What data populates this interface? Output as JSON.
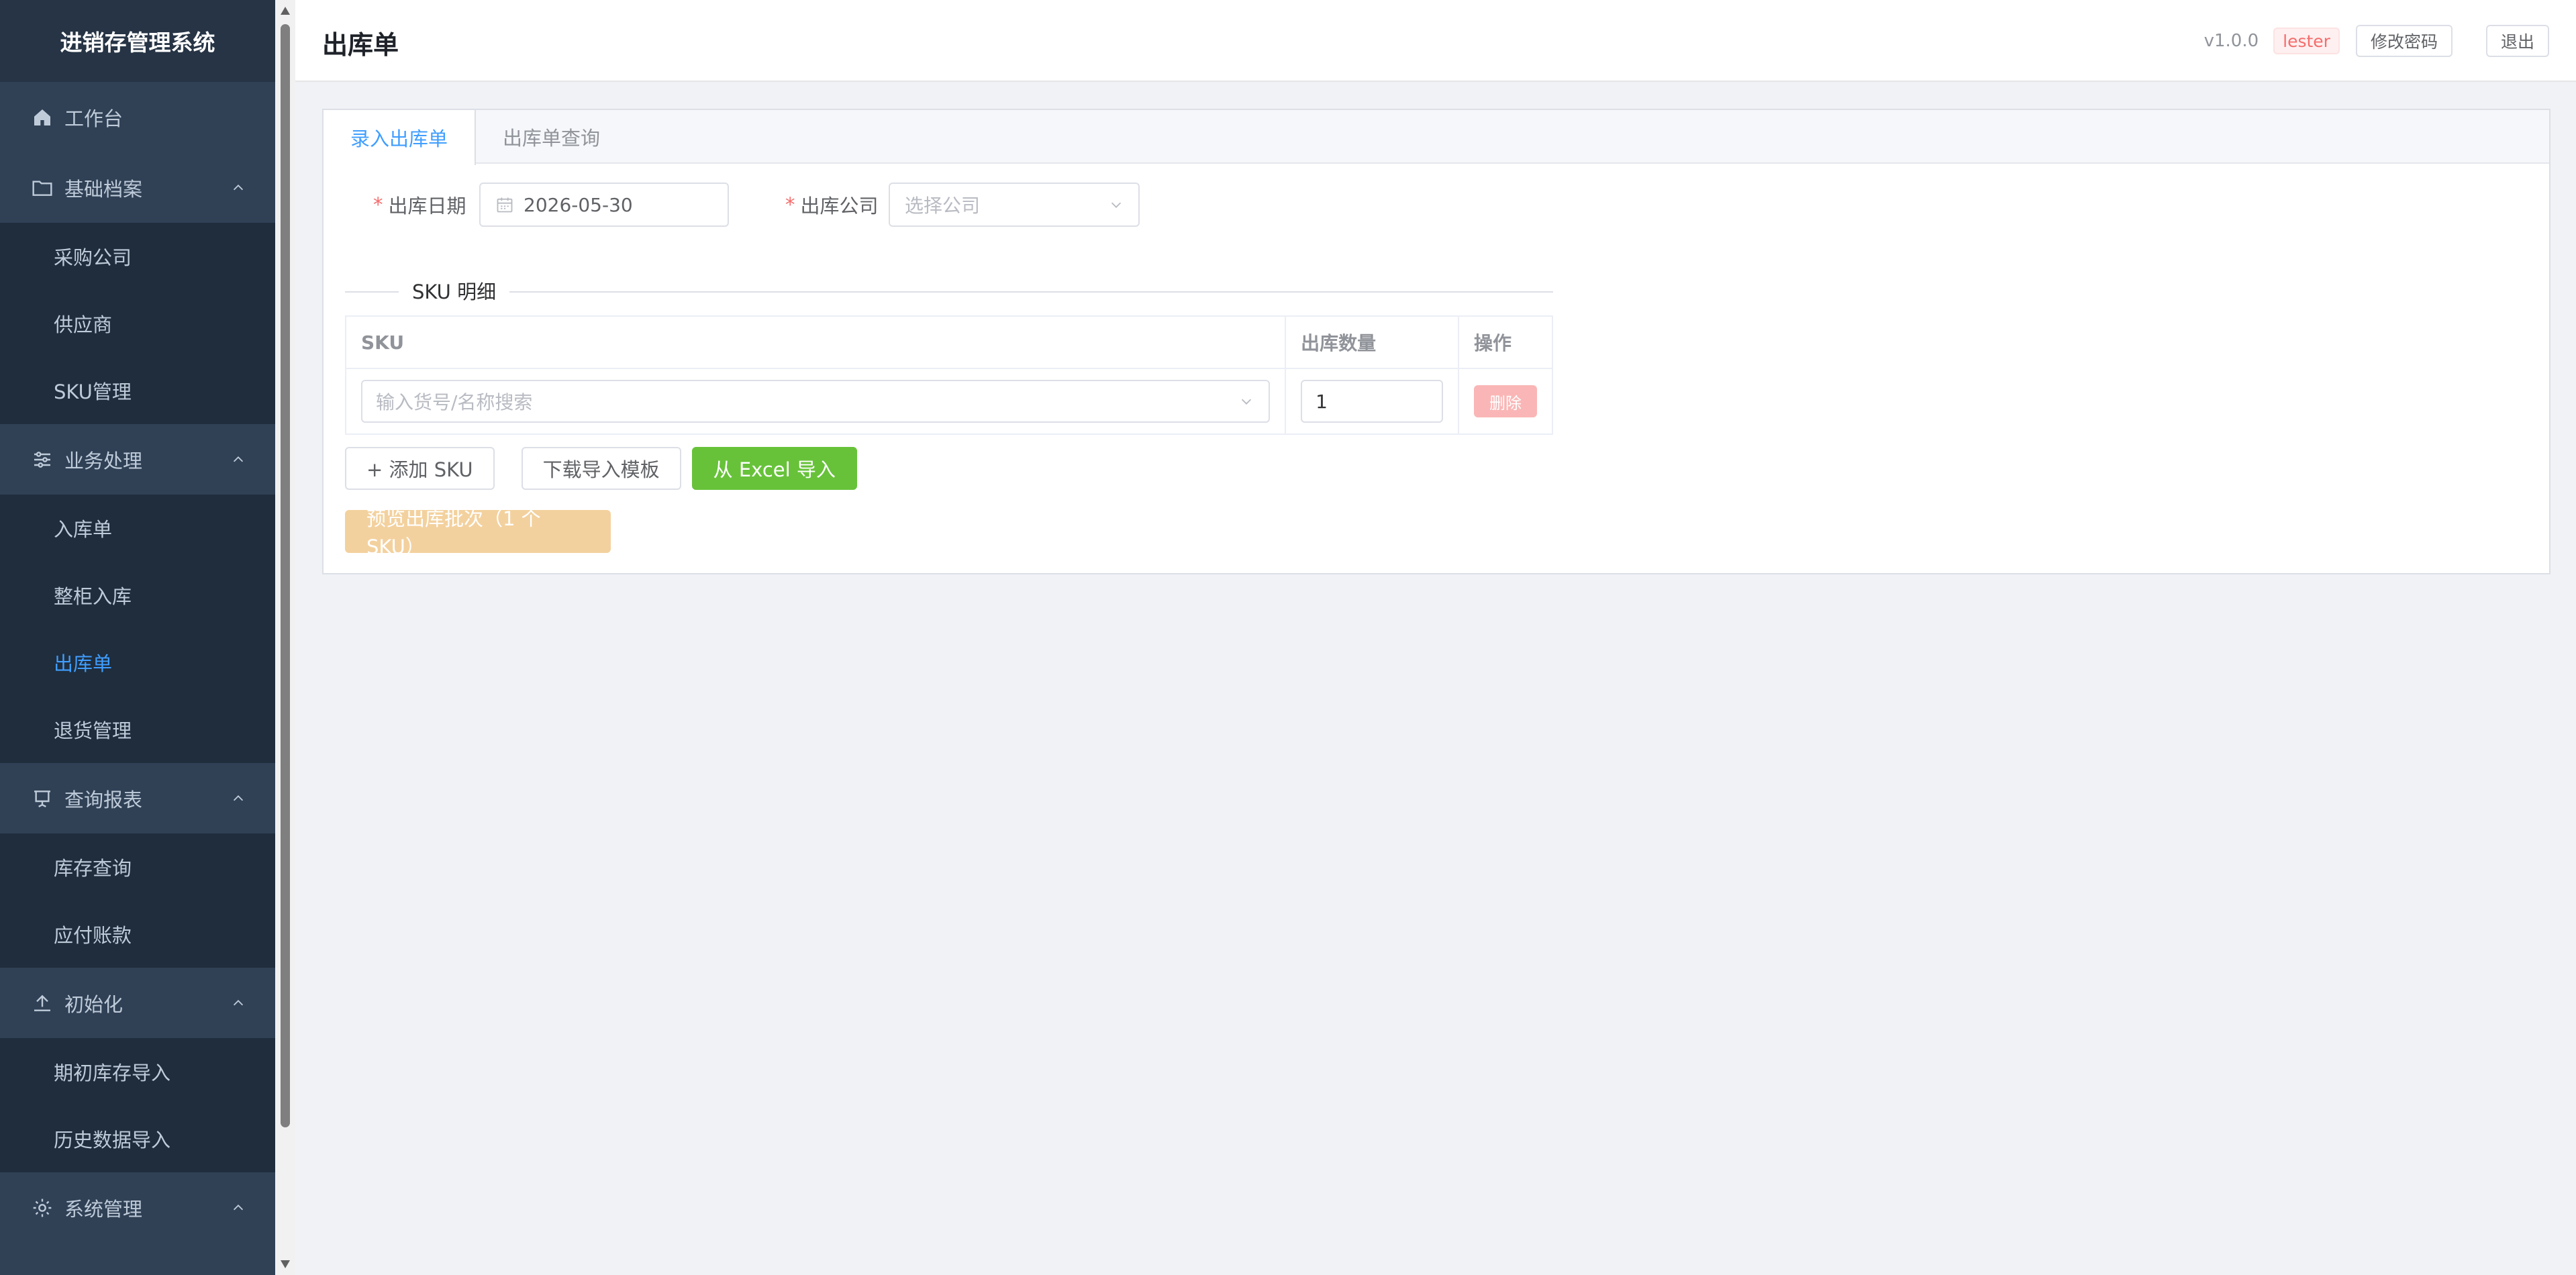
{
  "app": {
    "title": "进销存管理系统"
  },
  "sidebar": {
    "dashboard": "工作台",
    "groups": [
      {
        "label": "基础档案",
        "items": [
          "采购公司",
          "供应商",
          "SKU管理"
        ]
      },
      {
        "label": "业务处理",
        "items": [
          "入库单",
          "整柜入库",
          "出库单",
          "退货管理"
        ],
        "active": "出库单"
      },
      {
        "label": "查询报表",
        "items": [
          "库存查询",
          "应付账款"
        ]
      },
      {
        "label": "初始化",
        "items": [
          "期初库存导入",
          "历史数据导入"
        ]
      },
      {
        "label": "系统管理",
        "items": []
      }
    ]
  },
  "header": {
    "title": "出库单",
    "version": "v1.0.0",
    "user": "lester",
    "change_password": "修改密码",
    "logout": "退出"
  },
  "tabs": [
    "录入出库单",
    "出库单查询"
  ],
  "form": {
    "date_label": "出库日期",
    "date_value": "2026-05-30",
    "company_label": "出库公司",
    "company_placeholder": "选择公司"
  },
  "sku_section": {
    "title": "SKU 明细",
    "columns": [
      "SKU",
      "出库数量",
      "操作"
    ],
    "rows": [
      {
        "sku_placeholder": "输入货号/名称搜索",
        "qty": "1",
        "action": "删除"
      }
    ]
  },
  "buttons": {
    "add_sku": "+ 添加 SKU",
    "download_template": "下载导入模板",
    "import_excel": "从 Excel 导入",
    "preview": "预览出库批次（1 个SKU）"
  },
  "colors": {
    "sidebar_bg": "#304156",
    "accent": "#409eff",
    "success": "#67c23a",
    "danger_light": "#fab6b6",
    "warning_light": "#f3d19e"
  }
}
